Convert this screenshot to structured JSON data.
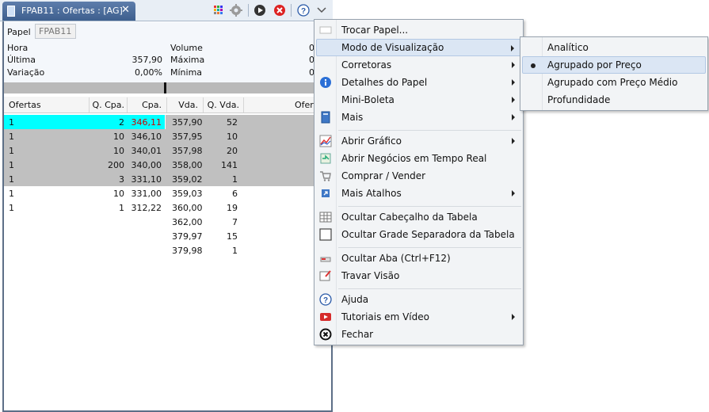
{
  "tab": {
    "title": "FPAB11 : Ofertas : [AG]",
    "close": "✕"
  },
  "header": {
    "papel_label": "Papel",
    "papel_value": "FPAB11",
    "hora_label": "Hora",
    "ultima_label": "Última",
    "ultima_value": "357,90",
    "variacao_label": "Variação",
    "variacao_value": "0,00%",
    "volume_label": "Volume",
    "volume_value": "0",
    "maxima_label": "Máxima",
    "maxima_value": "0",
    "minima_label": "Mínima",
    "minima_value": "0"
  },
  "table": {
    "columns": [
      "Ofertas",
      "Q. Cpa.",
      "Cpa.",
      "Vda.",
      "Q. Vda.",
      "Ofer"
    ],
    "rows": [
      {
        "ofertas": "1",
        "qcpa": "2",
        "cpa": "346,11",
        "vda": "357,90",
        "qvda": "52"
      },
      {
        "ofertas": "1",
        "qcpa": "10",
        "cpa": "346,10",
        "vda": "357,95",
        "qvda": "10"
      },
      {
        "ofertas": "1",
        "qcpa": "10",
        "cpa": "340,01",
        "vda": "357,98",
        "qvda": "20"
      },
      {
        "ofertas": "1",
        "qcpa": "200",
        "cpa": "340,00",
        "vda": "358,00",
        "qvda": "141"
      },
      {
        "ofertas": "1",
        "qcpa": "3",
        "cpa": "331,10",
        "vda": "359,02",
        "qvda": "1"
      },
      {
        "ofertas": "1",
        "qcpa": "10",
        "cpa": "331,00",
        "vda": "359,03",
        "qvda": "6"
      },
      {
        "ofertas": "1",
        "qcpa": "1",
        "cpa": "312,22",
        "vda": "360,00",
        "qvda": "19"
      },
      {
        "ofertas": "",
        "qcpa": "",
        "cpa": "",
        "vda": "362,00",
        "qvda": "7"
      },
      {
        "ofertas": "",
        "qcpa": "",
        "cpa": "",
        "vda": "379,97",
        "qvda": "15"
      },
      {
        "ofertas": "",
        "qcpa": "",
        "cpa": "",
        "vda": "379,98",
        "qvda": "1"
      }
    ]
  },
  "menu": {
    "items": [
      {
        "label": "Trocar Papel...",
        "icon": "blank-page-icon"
      },
      {
        "label": "Modo de Visualização",
        "icon": "",
        "submenu": true
      },
      {
        "label": "Corretoras",
        "icon": "",
        "submenu": true
      },
      {
        "label": "Detalhes do Papel",
        "icon": "info-icon",
        "submenu": true
      },
      {
        "label": "Mini-Boleta",
        "icon": "",
        "submenu": true
      },
      {
        "label": "Mais",
        "icon": "book-icon",
        "submenu": true
      },
      {
        "label": "Abrir Gráfico",
        "icon": "chart-icon",
        "submenu": true
      },
      {
        "label": "Abrir Negócios em Tempo Real",
        "icon": "realtime-icon"
      },
      {
        "label": "Comprar / Vender",
        "icon": "cart-icon"
      },
      {
        "label": "Mais Atalhos",
        "icon": "shortcut-icon",
        "submenu": true
      },
      {
        "label": "Ocultar Cabeçalho da Tabela",
        "icon": "table-icon"
      },
      {
        "label": "Ocultar Grade Separadora da Tabela",
        "icon": "grid-icon"
      },
      {
        "label": "Ocultar Aba (Ctrl+F12)",
        "icon": "tab-icon"
      },
      {
        "label": "Travar Visão",
        "icon": "pin-icon"
      },
      {
        "label": "Ajuda",
        "icon": "help-icon"
      },
      {
        "label": "Tutoriais em Vídeo",
        "icon": "video-icon",
        "submenu": true
      },
      {
        "label": "Fechar",
        "icon": "close-circle-icon"
      }
    ]
  },
  "submenu": {
    "items": [
      {
        "label": "Analítico"
      },
      {
        "label": "Agrupado por Preço",
        "selected": true
      },
      {
        "label": "Agrupado com Preço Médio"
      },
      {
        "label": "Profundidade"
      }
    ]
  },
  "colors": {
    "highlight_row": "#00ffff",
    "gray_row": "#c0c0c0",
    "buy_price_text": "#cc0000",
    "tab_blue": "#4a6b9a"
  }
}
